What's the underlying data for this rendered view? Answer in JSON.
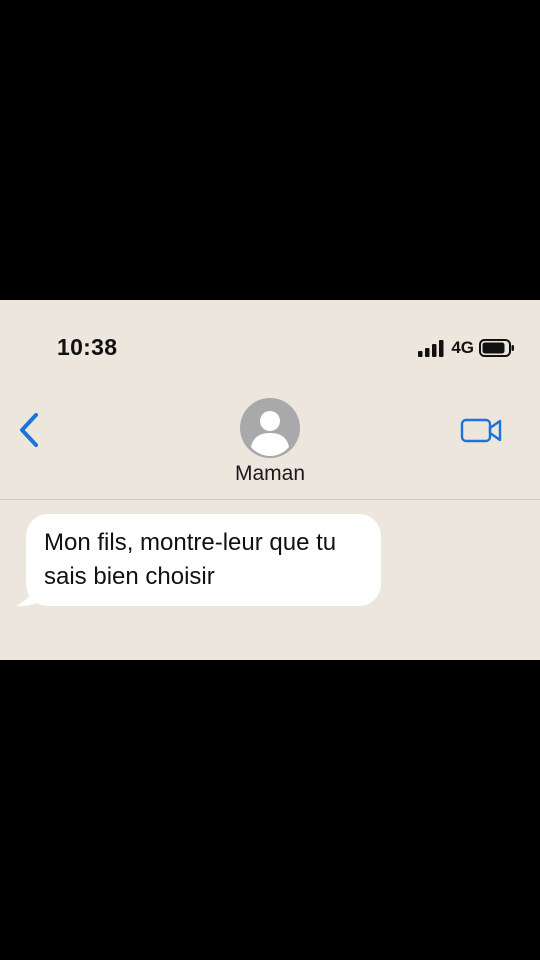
{
  "status_bar": {
    "time": "10:38",
    "network": "4G",
    "icons": [
      "signal-bars-icon",
      "battery-icon"
    ]
  },
  "header": {
    "back_icon": "chevron-left-icon",
    "avatar_icon": "person-avatar-icon",
    "contact_name": "Maman",
    "video_icon": "video-camera-icon"
  },
  "messages": [
    {
      "direction": "incoming",
      "text": "Mon fils, montre-leur que tu sais bien choisir"
    }
  ],
  "colors": {
    "background": "#ede6dd",
    "accent": "#1c73d9",
    "bubble": "#ffffff",
    "avatar": "#a9a9ac",
    "letterbox": "#000000"
  }
}
